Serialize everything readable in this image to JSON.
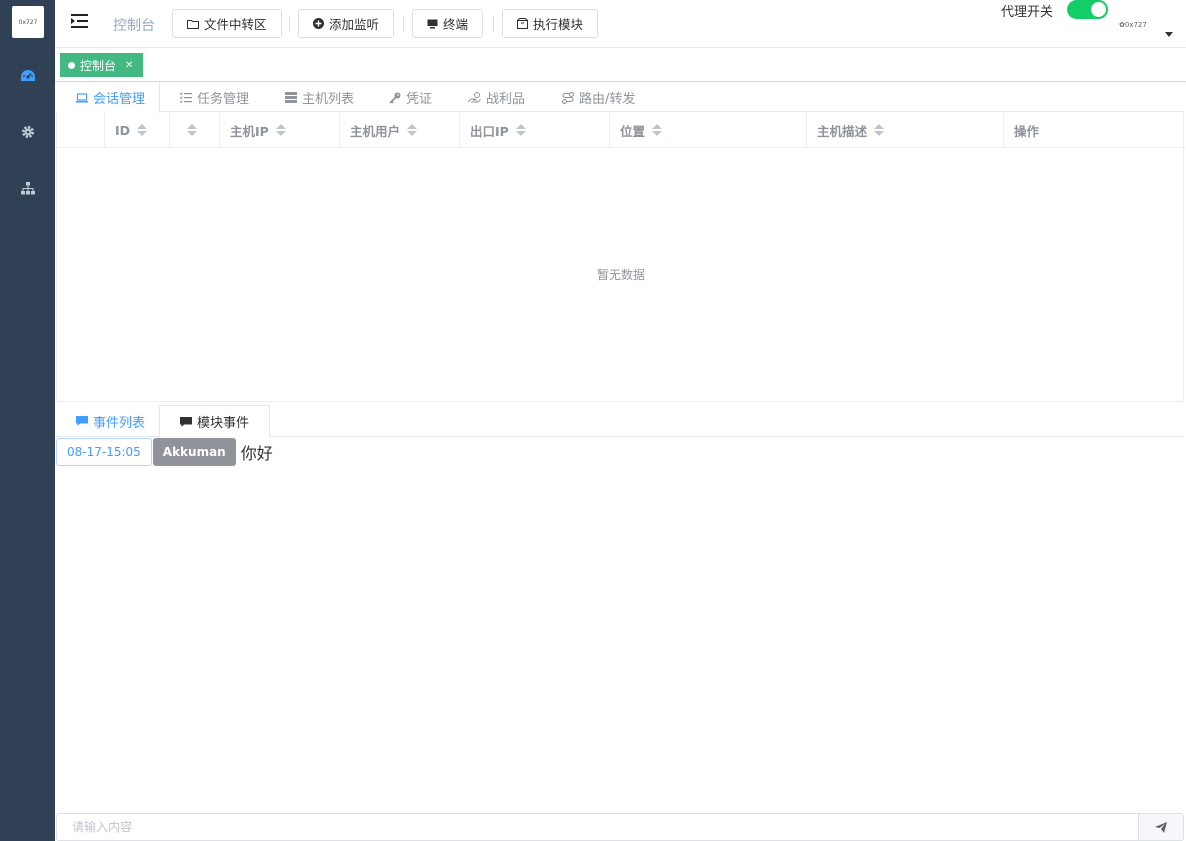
{
  "sidebar": {
    "logo_text": "0x727",
    "items": [
      {
        "icon": "dashboard-icon",
        "color": "#409eff"
      },
      {
        "icon": "gear-icon",
        "color": "#bfcbd9"
      },
      {
        "icon": "sitemap-icon",
        "color": "#bfcbd9"
      }
    ]
  },
  "header": {
    "breadcrumb": "控制台",
    "buttons": {
      "file_transfer": "文件中转区",
      "add_listener": "添加监听",
      "terminal": "终端",
      "exec_module": "执行模块"
    },
    "proxy_switch": {
      "label": "代理开关",
      "on": true
    },
    "user_avatar_text": "0x727"
  },
  "tags": {
    "active": "控制台"
  },
  "main_tabs": [
    "会话管理",
    "任务管理",
    "主机列表",
    "凭证",
    "战利品",
    "路由/转发"
  ],
  "table": {
    "columns": [
      "ID",
      "",
      "主机IP",
      "主机用户",
      "出口IP",
      "位置",
      "主机描述",
      "操作"
    ],
    "rows": [],
    "empty_text": "暂无数据"
  },
  "event_tabs": [
    "事件列表",
    "模块事件"
  ],
  "events": [
    {
      "time": "08-17-15:05",
      "user": "Akkuman",
      "message": "你好"
    }
  ],
  "chat_input": {
    "placeholder": "请输入内容",
    "value": ""
  },
  "colors": {
    "sidebar_bg": "#304156",
    "accent": "#409eff",
    "tag_active": "#42b983",
    "switch_on": "#13ce66"
  }
}
